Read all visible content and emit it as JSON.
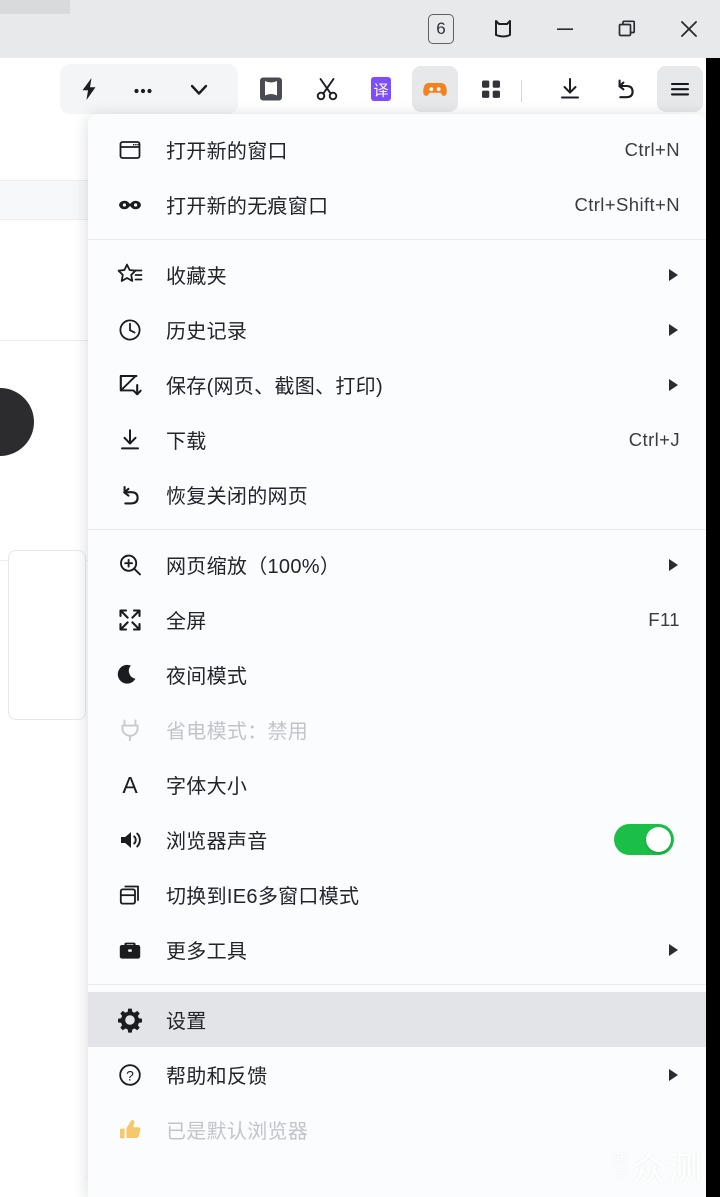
{
  "window": {
    "tab_count": "6",
    "controls": [
      {
        "name": "tab-count-badge",
        "label": "6"
      },
      {
        "name": "skin-icon",
        "label": ""
      },
      {
        "name": "minimize-button",
        "label": ""
      },
      {
        "name": "restore-button",
        "label": ""
      },
      {
        "name": "close-button",
        "label": ""
      }
    ]
  },
  "toolbar": {
    "items": [
      {
        "name": "quick-action-icon",
        "label": ""
      },
      {
        "name": "more-dots-icon",
        "label": ""
      },
      {
        "name": "chevron-down-icon",
        "label": ""
      },
      {
        "name": "reader-book-icon",
        "label": ""
      },
      {
        "name": "scissors-icon",
        "label": ""
      },
      {
        "name": "translate-icon",
        "label": "译"
      },
      {
        "name": "game-controller-icon",
        "label": ""
      },
      {
        "name": "apps-grid-icon",
        "label": ""
      },
      {
        "name": "download-icon",
        "label": ""
      },
      {
        "name": "undo-icon",
        "label": ""
      },
      {
        "name": "hamburger-menu-icon",
        "label": ""
      }
    ]
  },
  "menu": {
    "groups": [
      {
        "items": [
          {
            "icon": "new-window-icon",
            "label": "打开新的窗口",
            "shortcut": "Ctrl+N",
            "submenu": false,
            "disabled": false,
            "selected": false,
            "toggle": null
          },
          {
            "icon": "incognito-mask-icon",
            "label": "打开新的无痕窗口",
            "shortcut": "Ctrl+Shift+N",
            "submenu": false,
            "disabled": false,
            "selected": false,
            "toggle": null
          }
        ]
      },
      {
        "items": [
          {
            "icon": "favorites-star-icon",
            "label": "收藏夹",
            "shortcut": "",
            "submenu": true,
            "disabled": false,
            "selected": false,
            "toggle": null
          },
          {
            "icon": "history-clock-icon",
            "label": "历史记录",
            "shortcut": "",
            "submenu": true,
            "disabled": false,
            "selected": false,
            "toggle": null
          },
          {
            "icon": "save-page-icon",
            "label": "保存(网页、截图、打印)",
            "shortcut": "",
            "submenu": true,
            "disabled": false,
            "selected": false,
            "toggle": null
          },
          {
            "icon": "download-icon",
            "label": "下载",
            "shortcut": "Ctrl+J",
            "submenu": false,
            "disabled": false,
            "selected": false,
            "toggle": null
          },
          {
            "icon": "restore-tab-icon",
            "label": "恢复关闭的网页",
            "shortcut": "",
            "submenu": false,
            "disabled": false,
            "selected": false,
            "toggle": null
          }
        ]
      },
      {
        "items": [
          {
            "icon": "zoom-in-icon",
            "label": "网页缩放（100%）",
            "shortcut": "",
            "submenu": true,
            "disabled": false,
            "selected": false,
            "toggle": null
          },
          {
            "icon": "fullscreen-icon",
            "label": "全屏",
            "shortcut": "F11",
            "submenu": false,
            "disabled": false,
            "selected": false,
            "toggle": null
          },
          {
            "icon": "night-mode-moon-icon",
            "label": "夜间模式",
            "shortcut": "",
            "submenu": false,
            "disabled": false,
            "selected": false,
            "toggle": null
          },
          {
            "icon": "power-saver-plug-icon",
            "label": "省电模式：禁用",
            "shortcut": "",
            "submenu": false,
            "disabled": true,
            "selected": false,
            "toggle": null
          },
          {
            "icon": "font-size-icon",
            "label": "字体大小",
            "shortcut": "",
            "submenu": false,
            "disabled": false,
            "selected": false,
            "toggle": null
          },
          {
            "icon": "browser-sound-icon",
            "label": "浏览器声音",
            "shortcut": "",
            "submenu": false,
            "disabled": false,
            "selected": false,
            "toggle": "on"
          },
          {
            "icon": "ie6-window-icon",
            "label": "切换到IE6多窗口模式",
            "shortcut": "",
            "submenu": false,
            "disabled": false,
            "selected": false,
            "toggle": null
          },
          {
            "icon": "more-tools-briefcase-icon",
            "label": "更多工具",
            "shortcut": "",
            "submenu": true,
            "disabled": false,
            "selected": false,
            "toggle": null
          }
        ]
      },
      {
        "items": [
          {
            "icon": "settings-gear-icon",
            "label": "设置",
            "shortcut": "",
            "submenu": false,
            "disabled": false,
            "selected": true,
            "toggle": null
          },
          {
            "icon": "help-question-icon",
            "label": "帮助和反馈",
            "shortcut": "",
            "submenu": true,
            "disabled": false,
            "selected": false,
            "toggle": null
          },
          {
            "icon": "thumbs-up-icon",
            "label": "已是默认浏览器",
            "shortcut": "",
            "submenu": false,
            "disabled": true,
            "selected": false,
            "toggle": null
          }
        ]
      }
    ]
  },
  "watermark": {
    "small": "新浪",
    "big": "众测"
  },
  "colors": {
    "toggle_on": "#1bbf47",
    "menu_bg": "#fbfcfd",
    "selected_row": "#e2e4e7",
    "titlebar_bg": "#e8e9eb",
    "translate_accent": "#7d4dff",
    "game_accent": "#f58220"
  }
}
